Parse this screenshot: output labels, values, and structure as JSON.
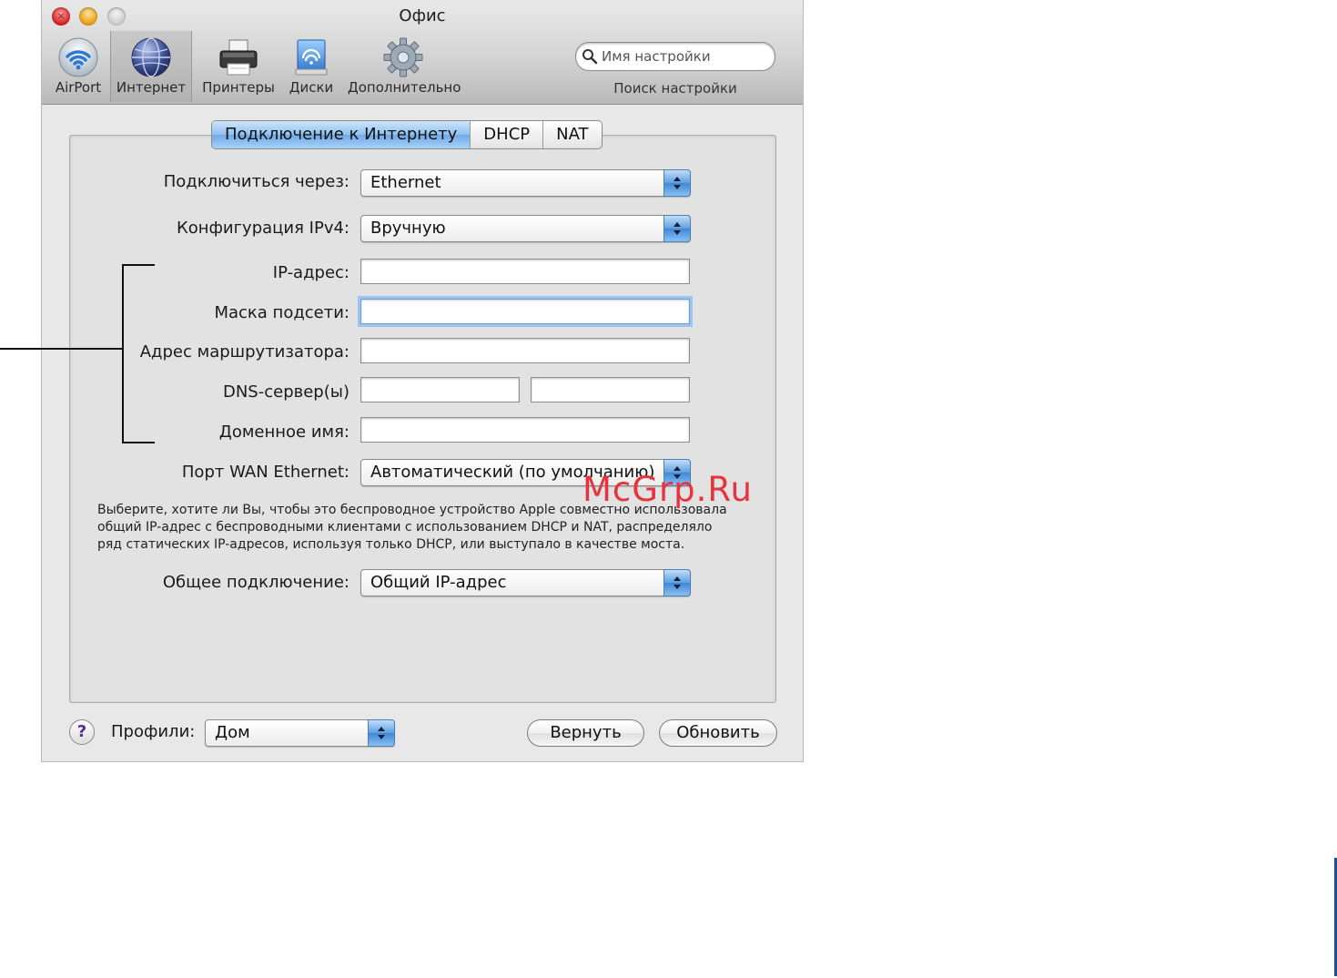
{
  "window": {
    "title": "Офис"
  },
  "toolbar": {
    "items": [
      {
        "label": "AirPort",
        "icon": "airport-wifi-icon",
        "selected": false
      },
      {
        "label": "Интернет",
        "icon": "globe-icon",
        "selected": true
      },
      {
        "label": "Принтеры",
        "icon": "printer-icon",
        "selected": false
      },
      {
        "label": "Диски",
        "icon": "disk-icon",
        "selected": false
      },
      {
        "label": "Дополнительно",
        "icon": "gear-icon",
        "selected": false
      }
    ],
    "search": {
      "placeholder": "Имя настройки",
      "caption": "Поиск настройки"
    }
  },
  "tabs": [
    {
      "label": "Подключение к Интернету",
      "active": true
    },
    {
      "label": "DHCP",
      "active": false
    },
    {
      "label": "NAT",
      "active": false
    }
  ],
  "form": {
    "connect_via": {
      "label": "Подключиться через:",
      "value": "Ethernet"
    },
    "ipv4_config": {
      "label": "Конфигурация IPv4:",
      "value": "Вручную"
    },
    "ip_address": {
      "label": "IP-адрес:",
      "value": ""
    },
    "subnet_mask": {
      "label": "Маска подсети:",
      "value": ""
    },
    "router_address": {
      "label": "Адрес маршрутизатора:",
      "value": ""
    },
    "dns_servers": {
      "label": "DNS-сервер(ы)",
      "value1": "",
      "value2": ""
    },
    "domain_name": {
      "label": "Доменное имя:",
      "value": ""
    },
    "wan_port": {
      "label": "Порт WAN Ethernet:",
      "value": "Автоматический (по умолчанию)"
    },
    "help_text": "Выберите, хотите ли Вы, чтобы это беспроводное устройство Apple совместно использовала общий IP-адрес с беспроводными клиентами с использованием DHCP и NAT, распределяло ряд статических IP-адресов, используя только DHCP, или выступало в качестве моста.",
    "connection_sharing": {
      "label": "Общее подключение:",
      "value": "Общий IP-адрес"
    }
  },
  "footer": {
    "help": "?",
    "profiles_label": "Профили:",
    "profile_value": "Дом",
    "revert_label": "Вернуть",
    "update_label": "Обновить"
  },
  "watermark": "McGrp.Ru",
  "colors": {
    "accent_blue": "#6fa9e6",
    "watermark_red": "#e8323c",
    "page_mark_blue": "#1b4f9c"
  }
}
